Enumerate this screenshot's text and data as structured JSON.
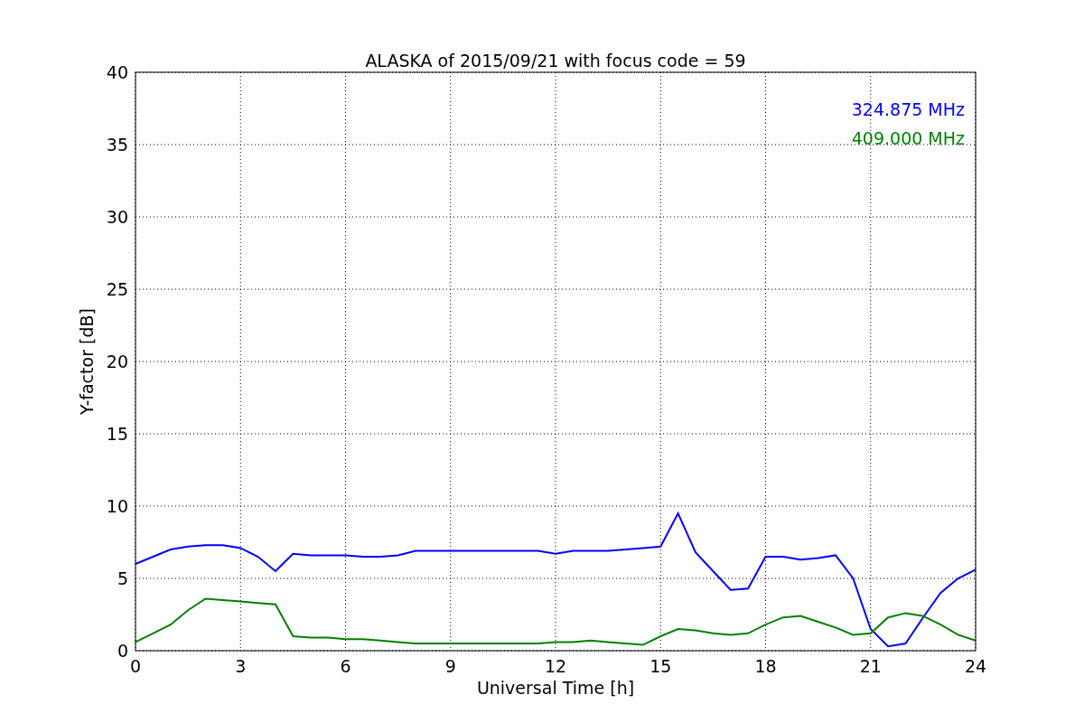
{
  "chart_data": {
    "type": "line",
    "title": "ALASKA of 2015/09/21 with focus code = 59",
    "xlabel": "Universal Time [h]",
    "ylabel": "Y-factor [dB]",
    "x": [
      0,
      0.5,
      1,
      1.5,
      2,
      2.5,
      3,
      3.5,
      4,
      4.5,
      5,
      5.5,
      6,
      6.5,
      7,
      7.5,
      8,
      8.5,
      9,
      9.5,
      10,
      10.5,
      11,
      11.5,
      12,
      12.5,
      13,
      13.5,
      14,
      14.5,
      15,
      15.5,
      16,
      16.5,
      17,
      17.5,
      18,
      18.5,
      19,
      19.5,
      20,
      20.5,
      21,
      21.5,
      22,
      22.5,
      23,
      23.5,
      24
    ],
    "series": [
      {
        "name": "324.875 MHz",
        "color": "#0000ff",
        "values": [
          6.0,
          6.5,
          7.0,
          7.2,
          7.3,
          7.3,
          7.1,
          6.5,
          5.5,
          6.7,
          6.6,
          6.6,
          6.6,
          6.5,
          6.5,
          6.6,
          6.9,
          6.9,
          6.9,
          6.9,
          6.9,
          6.9,
          6.9,
          6.9,
          6.7,
          6.9,
          6.9,
          6.9,
          7.0,
          7.1,
          7.2,
          9.5,
          6.8,
          5.5,
          4.2,
          4.3,
          6.5,
          6.5,
          6.3,
          6.4,
          6.6,
          5.0,
          1.5,
          0.3,
          0.5,
          2.3,
          4.0,
          5.0,
          5.6
        ]
      },
      {
        "name": "409.000 MHz",
        "color": "#008000",
        "values": [
          0.6,
          1.2,
          1.8,
          2.8,
          3.6,
          3.5,
          3.4,
          3.3,
          3.2,
          1.0,
          0.9,
          0.9,
          0.8,
          0.8,
          0.7,
          0.6,
          0.5,
          0.5,
          0.5,
          0.5,
          0.5,
          0.5,
          0.5,
          0.5,
          0.6,
          0.6,
          0.7,
          0.6,
          0.5,
          0.4,
          1.0,
          1.5,
          1.4,
          1.2,
          1.1,
          1.2,
          1.8,
          2.3,
          2.4,
          2.0,
          1.6,
          1.1,
          1.2,
          2.3,
          2.6,
          2.4,
          1.8,
          1.1,
          0.7
        ]
      }
    ],
    "grid": true,
    "xlim": [
      0,
      24
    ],
    "ylim": [
      0,
      40
    ],
    "xticks": [
      0,
      3,
      6,
      9,
      12,
      15,
      18,
      21,
      24
    ],
    "yticks": [
      0,
      5,
      10,
      15,
      20,
      25,
      30,
      35,
      40
    ]
  }
}
